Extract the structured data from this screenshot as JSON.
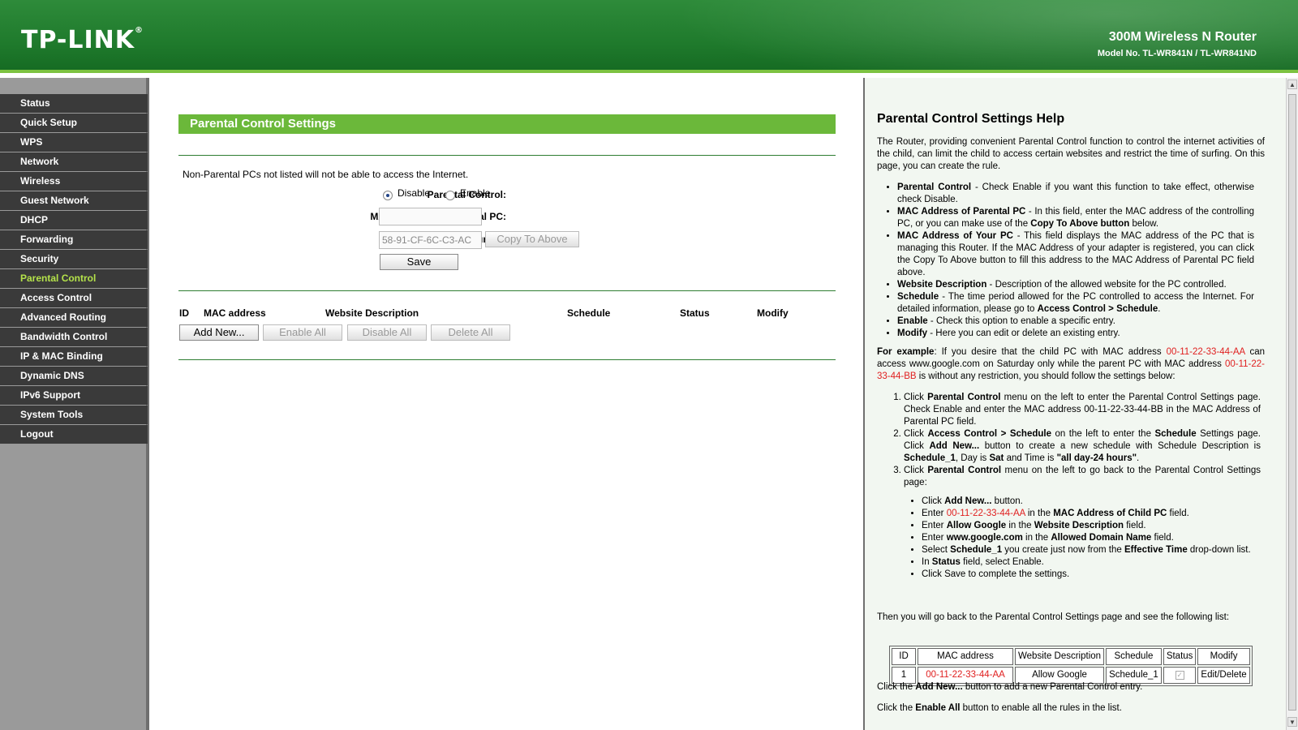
{
  "header": {
    "logo": "TP-LINK",
    "product_name": "300M Wireless N Router",
    "model_no": "Model No. TL-WR841N / TL-WR841ND"
  },
  "sidebar": {
    "items": [
      {
        "label": "Status"
      },
      {
        "label": "Quick Setup"
      },
      {
        "label": "WPS"
      },
      {
        "label": "Network"
      },
      {
        "label": "Wireless"
      },
      {
        "label": "Guest Network"
      },
      {
        "label": "DHCP"
      },
      {
        "label": "Forwarding"
      },
      {
        "label": "Security"
      },
      {
        "label": "Parental Control",
        "active": true
      },
      {
        "label": "Access Control"
      },
      {
        "label": "Advanced Routing"
      },
      {
        "label": "Bandwidth Control"
      },
      {
        "label": "IP & MAC Binding"
      },
      {
        "label": "Dynamic DNS"
      },
      {
        "label": "IPv6 Support"
      },
      {
        "label": "System Tools"
      },
      {
        "label": "Logout"
      }
    ]
  },
  "main": {
    "title": "Parental Control Settings",
    "note": "Non-Parental PCs not listed will not be able to access the Internet.",
    "parental_control_label": "Parental Control:",
    "disable_label": "Disable",
    "enable_label": "Enable",
    "parental_control_value": "Disable",
    "mac_parental_label": "MAC Address of Parental PC:",
    "mac_parental_value": "",
    "mac_your_pc_label": "MAC Address of Your PC:",
    "mac_your_pc_value": "58-91-CF-6C-C3-AC",
    "copy_to_above_label": "Copy To Above",
    "save_label": "Save",
    "columns": [
      "ID",
      "MAC address",
      "Website Description",
      "Schedule",
      "Status",
      "Modify"
    ],
    "add_new_label": "Add New...",
    "enable_all_label": "Enable All",
    "disable_all_label": "Disable All",
    "delete_all_label": "Delete All"
  },
  "help": {
    "title": "Parental Control Settings Help",
    "intro": "The Router, providing convenient Parental Control function to control the internet activities of the child, can limit the child to access certain websites and restrict the time of surfing. On this page, you can create the rule.",
    "items": [
      {
        "term": "Parental Control",
        "text": " - Check Enable if you want this function to take effect, otherwise check Disable."
      },
      {
        "term": "MAC Address of Parental PC",
        "text": " - In this field, enter the MAC address of the controlling PC, or you can make use of the ",
        "bold2": "Copy To Above button",
        "text2": " below."
      },
      {
        "term": "MAC Address of Your PC",
        "text": " - This field displays the MAC address of the PC that is managing this Router. If the MAC Address of your adapter is registered, you can click the Copy To Above button to fill this address to the MAC Address of Parental PC field above."
      },
      {
        "term": "Website Description",
        "text": " - Description of the allowed website for the PC controlled."
      },
      {
        "term": "Schedule",
        "text": " - The time period allowed for the PC controlled to access the Internet. For detailed information, please go to ",
        "bold2": "Access Control > Schedule",
        "text2": "."
      },
      {
        "term": "Enable",
        "text": " - Check this option to enable a specific entry."
      },
      {
        "term": "Modify",
        "text": " - Here you can edit or delete an existing entry."
      }
    ],
    "example": {
      "lead": "For example",
      "t1": ": If you desire that the child PC with MAC address ",
      "mac_child": "00-11-22-33-44-AA",
      "t2": " can access www.google.com on Saturday only while the parent PC with MAC address ",
      "mac_parent": "00-11-22-33-44-BB",
      "t3": " is without any restriction, you should follow the settings below:"
    },
    "steps": {
      "s1a": "Click ",
      "s1b": "Parental Control",
      "s1c": " menu on the left to enter the Parental Control Settings page. Check Enable and enter the MAC address 00-11-22-33-44-BB in the MAC Address of Parental PC field.",
      "s2a": "Click ",
      "s2b": "Access Control > Schedule",
      "s2c": " on the left to enter the ",
      "s2d": "Schedule",
      "s2e": " Settings page. Click ",
      "s2f": "Add New...",
      "s2g": " button to create a new schedule with Schedule Description is ",
      "s2h": "Schedule_1",
      "s2i": ", Day is ",
      "s2j": "Sat",
      "s2k": " and Time is ",
      "s2l": "\"all day-24 hours\"",
      "s2m": ".",
      "s3a": "Click ",
      "s3b": "Parental Control",
      "s3c": " menu on the left to go back to the Parental Control Settings page:"
    },
    "substeps": {
      "a1": "Click ",
      "a2": "Add New...",
      "a3": " button.",
      "b1": "Enter ",
      "b2": "00-11-22-33-44-AA",
      "b3": " in the ",
      "b4": "MAC Address of Child PC",
      "b5": " field.",
      "c1": "Enter ",
      "c2": "Allow Google",
      "c3": " in the ",
      "c4": "Website Description",
      "c5": " field.",
      "d1": "Enter ",
      "d2": "www.google.com",
      "d3": " in the ",
      "d4": "Allowed Domain Name",
      "d5": " field.",
      "e1": "Select ",
      "e2": "Schedule_1",
      "e3": " you create just now from the ",
      "e4": "Effective Time",
      "e5": " drop-down list.",
      "f1": "In ",
      "f2": "Status",
      "f3": " field, select Enable.",
      "g1": "Click Save to complete the settings."
    },
    "then_text": "Then you will go back to the Parental Control Settings page and see the following list:",
    "table": {
      "headers": [
        "ID",
        "MAC address",
        "Website Description",
        "Schedule",
        "Status",
        "Modify"
      ],
      "row": [
        "1",
        "00-11-22-33-44-AA",
        "Allow Google",
        "Schedule_1",
        "",
        "Edit/Delete"
      ]
    },
    "add_new_note": {
      "t1": "Click the ",
      "t2": "Add New...",
      "t3": " button to add a new Parental Control entry."
    },
    "enable_all_note": {
      "t1": "Click the ",
      "t2": "Enable All",
      "t3": " button to enable all the rules in the list."
    }
  }
}
